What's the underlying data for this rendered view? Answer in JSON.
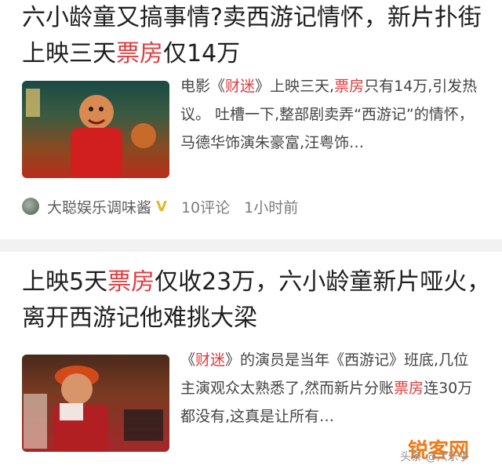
{
  "article1": {
    "title_pre": "六小龄童又搞事情?卖西游记情怀，新片扑街 上映三天",
    "title_hl": "票房",
    "title_post": "仅14万",
    "summary_pre": "电影《",
    "summary_film": "财迷",
    "summary_mid": "》上映三天,",
    "summary_hl": "票房",
    "summary_post": "只有14万,引发热议。 吐槽一下,整部剧卖弄“西游记”的情怀，马德华饰演朱豪富,汪粤饰…",
    "author": "大聪娱乐调味酱",
    "verified_badge": "V",
    "comments": "10评论",
    "time": "1小时前"
  },
  "article2": {
    "title_pre": "上映5天",
    "title_hl": "票房",
    "title_post": "仅收23万，六小龄童新片哑火，离开西游记他难挑大梁",
    "summary_pre": "《",
    "summary_film": "财迷",
    "summary_mid": "》的演员是当年《西游记》班底,几位主演观众太熟悉了,然而新片分账",
    "summary_hl": "票房",
    "summary_post": "连30万都没有,这真是让所有…"
  },
  "watermark": {
    "logo": "锐客网",
    "text": "头条 @六乐乎"
  },
  "colors": {
    "highlight": "#e4393c",
    "text": "#1f1f1f",
    "summary": "#444444",
    "meta": "#7b7b7b",
    "divider": "#f2f2f2"
  },
  "icons": {
    "avatar": "author-avatar",
    "verified": "verified-v-badge"
  }
}
